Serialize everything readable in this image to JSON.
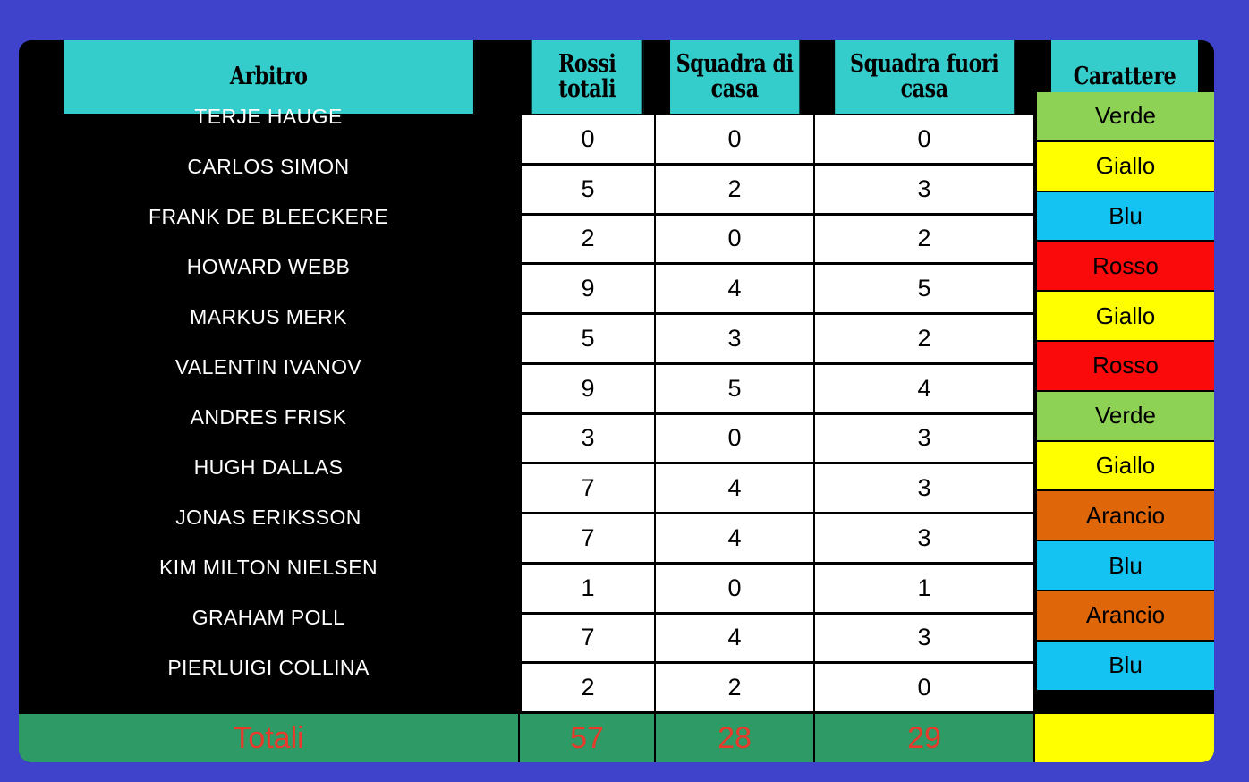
{
  "page": {
    "background_color": "#3f43cc",
    "card_background": "#000000"
  },
  "table": {
    "headers": {
      "arbitro": "Arbitro",
      "rossi_totali": "Rossi totali",
      "squadra_casa": "Squadra di casa",
      "squadra_fuori": "Squadra fuori casa",
      "carattere": "Carattere"
    },
    "header_background": "#35cccc",
    "rows": [
      {
        "arbitro": "TERJE HAUGE",
        "rossi": "0",
        "casa": "0",
        "fuori": "0",
        "carattere": "Verde",
        "carattere_color": "#8dd254"
      },
      {
        "arbitro": "CARLOS SIMON",
        "rossi": "5",
        "casa": "2",
        "fuori": "3",
        "carattere": "Giallo",
        "carattere_color": "#ffff00"
      },
      {
        "arbitro": "FRANK DE BLEECKERE",
        "rossi": "2",
        "casa": "0",
        "fuori": "2",
        "carattere": "Blu",
        "carattere_color": "#14c3f2"
      },
      {
        "arbitro": "HOWARD WEBB",
        "rossi": "9",
        "casa": "4",
        "fuori": "5",
        "carattere": "Rosso",
        "carattere_color": "#fa0a0a"
      },
      {
        "arbitro": "MARKUS MERK",
        "rossi": "5",
        "casa": "3",
        "fuori": "2",
        "carattere": "Giallo",
        "carattere_color": "#ffff00"
      },
      {
        "arbitro": "VALENTIN IVANOV",
        "rossi": "9",
        "casa": "5",
        "fuori": "4",
        "carattere": "Rosso",
        "carattere_color": "#fa0a0a"
      },
      {
        "arbitro": "ANDRES FRISK",
        "rossi": "3",
        "casa": "0",
        "fuori": "3",
        "carattere": "Verde",
        "carattere_color": "#8dd254"
      },
      {
        "arbitro": "HUGH DALLAS",
        "rossi": "7",
        "casa": "4",
        "fuori": "3",
        "carattere": "Giallo",
        "carattere_color": "#ffff00"
      },
      {
        "arbitro": "JONAS ERIKSSON",
        "rossi": "7",
        "casa": "4",
        "fuori": "3",
        "carattere": "Arancio",
        "carattere_color": "#e0660a"
      },
      {
        "arbitro": "KIM MILTON  NIELSEN",
        "rossi": "1",
        "casa": "0",
        "fuori": "1",
        "carattere": "Blu",
        "carattere_color": "#14c3f2"
      },
      {
        "arbitro": "GRAHAM POLL",
        "rossi": "7",
        "casa": "4",
        "fuori": "3",
        "carattere": "Arancio",
        "carattere_color": "#e0660a"
      },
      {
        "arbitro": "PIERLUIGI COLLINA",
        "rossi": "2",
        "casa": "2",
        "fuori": "0",
        "carattere": "Blu",
        "carattere_color": "#14c3f2"
      }
    ],
    "totals": {
      "label": "Totali",
      "rossi": "57",
      "casa": "28",
      "fuori": "29",
      "carattere": "",
      "row_background": "#2e9a66",
      "text_color": "#e8392a",
      "carattere_color": "#ffff00"
    }
  },
  "chart_data": {
    "type": "table",
    "title": "Cartellini rossi per arbitro",
    "columns": [
      "Arbitro",
      "Rossi totali",
      "Squadra di casa",
      "Squadra fuori casa",
      "Carattere"
    ],
    "rows": [
      [
        "TERJE HAUGE",
        0,
        0,
        0,
        "Verde"
      ],
      [
        "CARLOS SIMON",
        5,
        2,
        3,
        "Giallo"
      ],
      [
        "FRANK DE BLEECKERE",
        2,
        0,
        2,
        "Blu"
      ],
      [
        "HOWARD WEBB",
        9,
        4,
        5,
        "Rosso"
      ],
      [
        "MARKUS MERK",
        5,
        3,
        2,
        "Giallo"
      ],
      [
        "VALENTIN IVANOV",
        9,
        5,
        4,
        "Rosso"
      ],
      [
        "ANDRES FRISK",
        3,
        0,
        3,
        "Verde"
      ],
      [
        "HUGH DALLAS",
        7,
        4,
        3,
        "Giallo"
      ],
      [
        "JONAS ERIKSSON",
        7,
        4,
        3,
        "Arancio"
      ],
      [
        "KIM MILTON  NIELSEN",
        1,
        0,
        1,
        "Blu"
      ],
      [
        "GRAHAM POLL",
        7,
        4,
        3,
        "Arancio"
      ],
      [
        "PIERLUIGI COLLINA",
        2,
        2,
        0,
        "Blu"
      ]
    ],
    "totals": [
      "Totali",
      57,
      28,
      29,
      ""
    ]
  }
}
